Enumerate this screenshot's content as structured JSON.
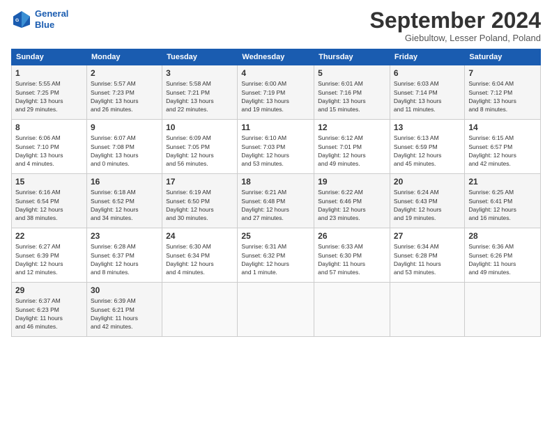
{
  "logo": {
    "line1": "General",
    "line2": "Blue"
  },
  "title": "September 2024",
  "subtitle": "Giebultow, Lesser Poland, Poland",
  "days_header": [
    "Sunday",
    "Monday",
    "Tuesday",
    "Wednesday",
    "Thursday",
    "Friday",
    "Saturday"
  ],
  "weeks": [
    [
      {
        "num": "1",
        "rise": "5:55 AM",
        "set": "7:25 PM",
        "daylight": "13 hours and 29 minutes."
      },
      {
        "num": "2",
        "rise": "5:57 AM",
        "set": "7:23 PM",
        "daylight": "13 hours and 26 minutes."
      },
      {
        "num": "3",
        "rise": "5:58 AM",
        "set": "7:21 PM",
        "daylight": "13 hours and 22 minutes."
      },
      {
        "num": "4",
        "rise": "6:00 AM",
        "set": "7:19 PM",
        "daylight": "13 hours and 19 minutes."
      },
      {
        "num": "5",
        "rise": "6:01 AM",
        "set": "7:16 PM",
        "daylight": "13 hours and 15 minutes."
      },
      {
        "num": "6",
        "rise": "6:03 AM",
        "set": "7:14 PM",
        "daylight": "13 hours and 11 minutes."
      },
      {
        "num": "7",
        "rise": "6:04 AM",
        "set": "7:12 PM",
        "daylight": "13 hours and 8 minutes."
      }
    ],
    [
      {
        "num": "8",
        "rise": "6:06 AM",
        "set": "7:10 PM",
        "daylight": "13 hours and 4 minutes."
      },
      {
        "num": "9",
        "rise": "6:07 AM",
        "set": "7:08 PM",
        "daylight": "13 hours and 0 minutes."
      },
      {
        "num": "10",
        "rise": "6:09 AM",
        "set": "7:05 PM",
        "daylight": "12 hours and 56 minutes."
      },
      {
        "num": "11",
        "rise": "6:10 AM",
        "set": "7:03 PM",
        "daylight": "12 hours and 53 minutes."
      },
      {
        "num": "12",
        "rise": "6:12 AM",
        "set": "7:01 PM",
        "daylight": "12 hours and 49 minutes."
      },
      {
        "num": "13",
        "rise": "6:13 AM",
        "set": "6:59 PM",
        "daylight": "12 hours and 45 minutes."
      },
      {
        "num": "14",
        "rise": "6:15 AM",
        "set": "6:57 PM",
        "daylight": "12 hours and 42 minutes."
      }
    ],
    [
      {
        "num": "15",
        "rise": "6:16 AM",
        "set": "6:54 PM",
        "daylight": "12 hours and 38 minutes."
      },
      {
        "num": "16",
        "rise": "6:18 AM",
        "set": "6:52 PM",
        "daylight": "12 hours and 34 minutes."
      },
      {
        "num": "17",
        "rise": "6:19 AM",
        "set": "6:50 PM",
        "daylight": "12 hours and 30 minutes."
      },
      {
        "num": "18",
        "rise": "6:21 AM",
        "set": "6:48 PM",
        "daylight": "12 hours and 27 minutes."
      },
      {
        "num": "19",
        "rise": "6:22 AM",
        "set": "6:46 PM",
        "daylight": "12 hours and 23 minutes."
      },
      {
        "num": "20",
        "rise": "6:24 AM",
        "set": "6:43 PM",
        "daylight": "12 hours and 19 minutes."
      },
      {
        "num": "21",
        "rise": "6:25 AM",
        "set": "6:41 PM",
        "daylight": "12 hours and 16 minutes."
      }
    ],
    [
      {
        "num": "22",
        "rise": "6:27 AM",
        "set": "6:39 PM",
        "daylight": "12 hours and 12 minutes."
      },
      {
        "num": "23",
        "rise": "6:28 AM",
        "set": "6:37 PM",
        "daylight": "12 hours and 8 minutes."
      },
      {
        "num": "24",
        "rise": "6:30 AM",
        "set": "6:34 PM",
        "daylight": "12 hours and 4 minutes."
      },
      {
        "num": "25",
        "rise": "6:31 AM",
        "set": "6:32 PM",
        "daylight": "12 hours and 1 minute."
      },
      {
        "num": "26",
        "rise": "6:33 AM",
        "set": "6:30 PM",
        "daylight": "11 hours and 57 minutes."
      },
      {
        "num": "27",
        "rise": "6:34 AM",
        "set": "6:28 PM",
        "daylight": "11 hours and 53 minutes."
      },
      {
        "num": "28",
        "rise": "6:36 AM",
        "set": "6:26 PM",
        "daylight": "11 hours and 49 minutes."
      }
    ],
    [
      {
        "num": "29",
        "rise": "6:37 AM",
        "set": "6:23 PM",
        "daylight": "11 hours and 46 minutes."
      },
      {
        "num": "30",
        "rise": "6:39 AM",
        "set": "6:21 PM",
        "daylight": "11 hours and 42 minutes."
      },
      null,
      null,
      null,
      null,
      null
    ]
  ]
}
